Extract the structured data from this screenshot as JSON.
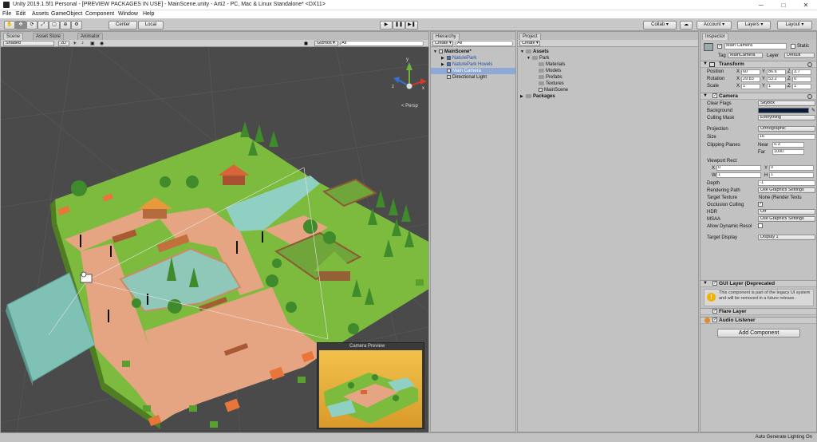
{
  "window": {
    "title": "Unity 2019.1.5f1 Personal - [PREVIEW PACKAGES IN USE] - MainScene.unity - Arti2 - PC, Mac & Linux Standalone* <DX11>",
    "minimize": "─",
    "maximize": "□",
    "close": "✕"
  },
  "menu": [
    "File",
    "Edit",
    "Assets",
    "GameObject",
    "Component",
    "Window",
    "Help"
  ],
  "toolbar": {
    "pivot": "Center",
    "space": "Local",
    "play": "▶",
    "pause": "❚❚",
    "step": "▶❚",
    "collab": "Collab ▾",
    "cloud": "☁",
    "account": "Account ▾",
    "layers": "Layers ▾",
    "layout": "Layout ▾"
  },
  "scene": {
    "tabs": [
      "Scene",
      "Asset Store",
      "Animator"
    ],
    "shading": "Shaded",
    "mode2d": "2D",
    "gizmos": "Gizmos ▾",
    "search": "All",
    "persp": "< Persp",
    "gizmo_axes": {
      "y": "y",
      "x": "x",
      "z": "z"
    },
    "camera_preview_title": "Camera Preview"
  },
  "hierarchy": {
    "tab": "Hierarchy",
    "create": "Create ▾",
    "search": "All",
    "items": [
      {
        "label": "MainScene*",
        "indent": 0,
        "arrow": "▼",
        "bold": true
      },
      {
        "label": "NaturePark",
        "indent": 1,
        "arrow": "▶",
        "blue": true
      },
      {
        "label": "NaturePark Hovels",
        "indent": 1,
        "arrow": "▶",
        "blue": true
      },
      {
        "label": "Main Camera",
        "indent": 1,
        "arrow": "",
        "selected": true
      },
      {
        "label": "Directional Light",
        "indent": 1,
        "arrow": ""
      }
    ]
  },
  "project": {
    "tab": "Project",
    "create": "Create ▾",
    "items": [
      {
        "label": "Assets",
        "indent": 0,
        "arrow": "▼",
        "bold": true,
        "icon": "folder"
      },
      {
        "label": "Park",
        "indent": 1,
        "arrow": "▼",
        "icon": "folder"
      },
      {
        "label": "Materials",
        "indent": 2,
        "arrow": "",
        "icon": "folder"
      },
      {
        "label": "Models",
        "indent": 2,
        "arrow": "",
        "icon": "folder"
      },
      {
        "label": "Prefabs",
        "indent": 2,
        "arrow": "",
        "icon": "folder"
      },
      {
        "label": "Textures",
        "indent": 2,
        "arrow": "",
        "icon": "folder"
      },
      {
        "label": "MainScene",
        "indent": 2,
        "arrow": "",
        "icon": "scene"
      },
      {
        "label": "Packages",
        "indent": 0,
        "arrow": "▶",
        "bold": true,
        "icon": "folder"
      }
    ]
  },
  "inspector": {
    "tab": "Inspector",
    "object_name": "Main Camera",
    "static": "Static",
    "tag_label": "Tag",
    "tag": "MainCamera",
    "layer_label": "Layer",
    "layer": "Default",
    "transform": {
      "title": "Transform",
      "position_label": "Position",
      "rotation_label": "Rotation",
      "scale_label": "Scale",
      "position": {
        "x": "60",
        "y": "86.6",
        "z": "3.7"
      },
      "rotation": {
        "x": "29.83",
        "y": "53.2",
        "z": "0"
      },
      "scale": {
        "x": "1",
        "y": "1",
        "z": "1"
      }
    },
    "camera": {
      "title": "Camera",
      "clear_flags_label": "Clear Flags",
      "clear_flags": "Skybox",
      "background_label": "Background",
      "culling_mask_label": "Culling Mask",
      "culling_mask": "Everything",
      "projection_label": "Projection",
      "projection": "Orthographic",
      "size_label": "Size",
      "size": "16",
      "clipping_label": "Clipping Planes",
      "near_label": "Near",
      "near": "0.3",
      "far_label": "Far",
      "far": "1000",
      "viewport_label": "Viewport Rect",
      "vx_label": "X",
      "vx": "0",
      "vy_label": "Y",
      "vy": "0",
      "vw_label": "W",
      "vw": "1",
      "vh_label": "H",
      "vh": "1",
      "depth_label": "Depth",
      "depth": "-1",
      "rendering_path_label": "Rendering Path",
      "rendering_path": "Use Graphics Settings",
      "target_texture_label": "Target Texture",
      "target_texture": "None (Render Textu",
      "occlusion_label": "Occlusion Culling",
      "hdr_label": "HDR",
      "hdr": "Off",
      "msaa_label": "MSAA",
      "msaa": "Use Graphics Settings",
      "dynamic_res_label": "Allow Dynamic Resol",
      "target_display_label": "Target Display",
      "target_display": "Display 1",
      "background_color": "#0b1a3a"
    },
    "gui_layer": {
      "title": "GUI Layer (Deprecated",
      "warning": "This component is part of the legacy UI system and will be removed in a future release."
    },
    "flare_layer": {
      "title": "Flare Layer"
    },
    "audio_listener": {
      "title": "Audio Listener"
    },
    "add_component": "Add Component"
  },
  "statusbar": {
    "text": "Auto Generate Lighting On"
  },
  "colors": {
    "accent_blue": "#3f72c9",
    "selection": "#8fa9d6",
    "ground": "#7cb342",
    "water": "#6fb3b1",
    "path": "#e9a37f"
  }
}
